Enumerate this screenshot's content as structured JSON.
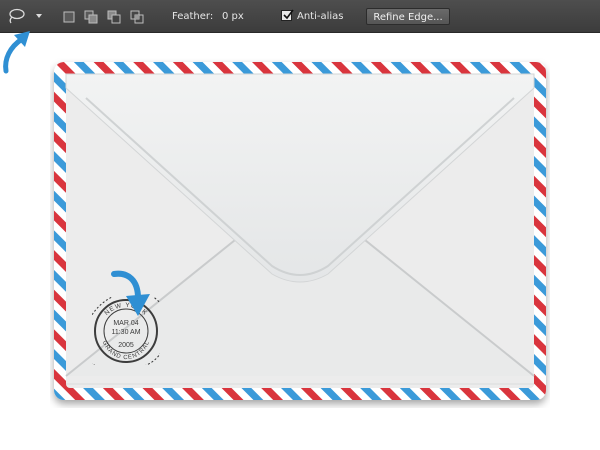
{
  "toolbar": {
    "tool_icon": "lasso-icon",
    "feather_label": "Feather:",
    "feather_value": "0 px",
    "antialias_label": "Anti-alias",
    "antialias_checked": true,
    "refine_edge_label": "Refine Edge..."
  },
  "postmark": {
    "city": "NEW YORK",
    "date": "MAR 04",
    "time": "11:30 AM",
    "year": "2005",
    "bottom_text": "GRAND CENTRAL"
  },
  "colors": {
    "toolbar_bg": "#434343",
    "stripe_red": "#d9363e",
    "stripe_blue": "#3b9ad9",
    "arrow_blue": "#2f8fd3",
    "envelope_paper": "#ededed"
  }
}
